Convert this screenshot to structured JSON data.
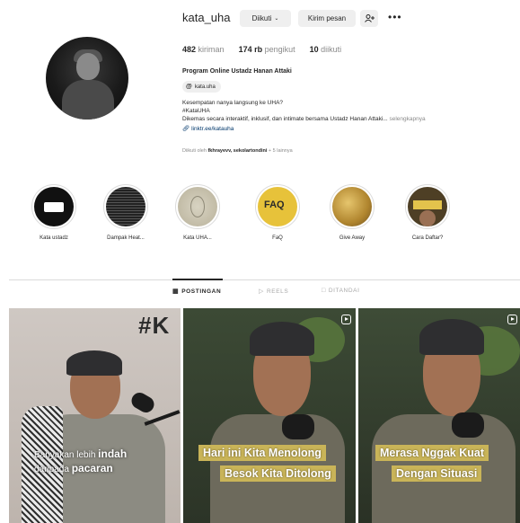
{
  "profile": {
    "username": "kata_uha",
    "follow_button": "Diikuti",
    "message_button": "Kirim pesan",
    "add_user_icon": "add-user-icon",
    "more_icon": "•••",
    "posts_count": "482",
    "posts_label": "kiriman",
    "followers_count": "174 rb",
    "followers_label": "pengikut",
    "following_count": "10",
    "following_label": "diikuti",
    "full_name": "Program Online Ustadz Hanan Attaki",
    "threads_handle": "kata.uha",
    "bio_line1": "Kesempatan nanya langsung ke UHA?",
    "bio_line2": "#KataUHA",
    "bio_line3": "Dikemas secara interaktif, inklusif, dan intimate bersama Ustadz Hanan Attaki...",
    "bio_more": "selengkapnya",
    "link": "linktr.ee/katauha",
    "followed_by_prefix": "Diikuti oleh",
    "followed_by_names": "fkhrayevv, sekolartondini",
    "followed_by_suffix": "+ 5 lainnya"
  },
  "highlights": [
    {
      "label": "Kata ustadz"
    },
    {
      "label": "Dampak Heat..."
    },
    {
      "label": "Kata UHA..."
    },
    {
      "label": "FaQ"
    },
    {
      "label": "Give Away"
    },
    {
      "label": "Cara Daftar?"
    }
  ],
  "highlight_faq_text": "FAQ",
  "tabs": [
    {
      "label": "POSTINGAN"
    },
    {
      "label": "REELS"
    },
    {
      "label": "DITANDAI"
    }
  ],
  "posts": [
    {
      "hashtag": "#K",
      "caption_a": "Banyakan lebih",
      "caption_b": "indah",
      "caption_c": "daripada",
      "caption_d": "pacaran"
    },
    {
      "caption_line1": "Hari ini Kita Menolong",
      "caption_line2": "Besok Kita Ditolong"
    },
    {
      "caption_line1": "Merasa Nggak Kuat",
      "caption_line2": "Dengan Situasi"
    }
  ]
}
